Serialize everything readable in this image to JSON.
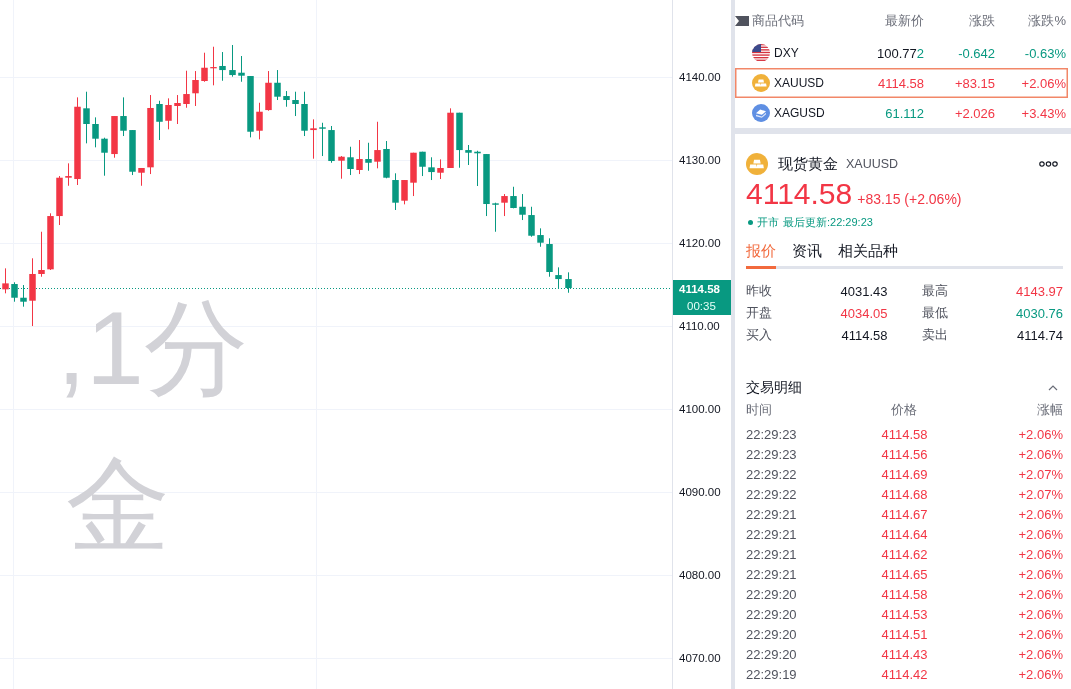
{
  "chart": {
    "watermark": [
      ",1分",
      "金"
    ],
    "chart_data": [
      {
        "type": "candlestick",
        "ohlc": [
          [
            4114.42,
            4116.95,
            4113.94,
            4115.14
          ],
          [
            4115.06,
            4115.27,
            4112.93,
            4113.41
          ],
          [
            4113.41,
            4114.94,
            4112.33,
            4112.93
          ],
          [
            4113.05,
            4118.16,
            4110.0,
            4116.27
          ],
          [
            4116.27,
            4121.36,
            4115.94,
            4116.75
          ],
          [
            4116.83,
            4123.58,
            4116.75,
            4123.25
          ],
          [
            4123.25,
            4128.07,
            4122.17,
            4127.87
          ],
          [
            4127.87,
            4129.6,
            4126.9,
            4128.07
          ],
          [
            4127.71,
            4137.55,
            4126.99,
            4136.42
          ],
          [
            4136.23,
            4138.23,
            4132.01,
            4134.34
          ],
          [
            4134.34,
            4135.14,
            4131.53,
            4132.57
          ],
          [
            4132.57,
            4132.69,
            4128.11,
            4130.88
          ],
          [
            4130.72,
            4135.3,
            4130.28,
            4135.3
          ],
          [
            4135.3,
            4137.55,
            4132.89,
            4133.53
          ],
          [
            4133.61,
            4133.61,
            4128.19,
            4128.59
          ],
          [
            4128.47,
            4129.04,
            4126.9,
            4129.04
          ],
          [
            4129.12,
            4137.83,
            4128.31,
            4136.27
          ],
          [
            4136.75,
            4137.14,
            4132.41,
            4134.61
          ],
          [
            4134.73,
            4137.43,
            4133.7,
            4136.63
          ],
          [
            4136.51,
            4137.83,
            4134.34,
            4136.87
          ],
          [
            4136.75,
            4140.76,
            4136.3,
            4137.95
          ],
          [
            4138.04,
            4140.72,
            4136.51,
            4139.64
          ],
          [
            4139.52,
            4142.93,
            4139.43,
            4141.12
          ],
          [
            4141.05,
            4143.65,
            4139.0,
            4141.2
          ],
          [
            4141.33,
            4143.01,
            4139.55,
            4140.84
          ],
          [
            4140.84,
            4143.86,
            4140.04,
            4140.24
          ],
          [
            4140.52,
            4142.53,
            4139.43,
            4140.16
          ],
          [
            4140.12,
            4140.12,
            4132.73,
            4133.41
          ],
          [
            4133.53,
            4136.9,
            4132.49,
            4135.82
          ],
          [
            4136.02,
            4140.72,
            4135.94,
            4139.31
          ],
          [
            4139.31,
            4140.84,
            4137.23,
            4137.63
          ],
          [
            4137.71,
            4138.31,
            4136.42,
            4137.23
          ],
          [
            4137.23,
            4138.23,
            4135.3,
            4136.75
          ],
          [
            4136.75,
            4138.23,
            4132.89,
            4133.53
          ],
          [
            4133.61,
            4134.9,
            4130.16,
            4133.82
          ],
          [
            4133.94,
            4134.49,
            4130.48,
            4133.77
          ],
          [
            4133.61,
            4134.1,
            4129.67,
            4129.88
          ],
          [
            4129.92,
            4130.48,
            4127.75,
            4130.4
          ],
          [
            4130.33,
            4131.6,
            4128.19,
            4128.92
          ],
          [
            4128.8,
            4132.41,
            4128.31,
            4130.12
          ],
          [
            4130.12,
            4132.08,
            4128.71,
            4129.67
          ],
          [
            4129.8,
            4134.61,
            4129.0,
            4131.2
          ],
          [
            4131.33,
            4132.29,
            4127.8,
            4127.87
          ],
          [
            4127.59,
            4128.4,
            4123.98,
            4124.86
          ],
          [
            4125.1,
            4127.59,
            4124.66,
            4127.59
          ],
          [
            4127.27,
            4130.88,
            4125.66,
            4130.88
          ],
          [
            4131.0,
            4131.0,
            4128.07,
            4129.19
          ],
          [
            4129.12,
            4130.33,
            4127.59,
            4128.55
          ],
          [
            4128.47,
            4130.08,
            4127.71,
            4129.04
          ],
          [
            4129.04,
            4136.23,
            4129.04,
            4135.7
          ],
          [
            4135.7,
            4135.7,
            4129.07,
            4131.2
          ],
          [
            4131.2,
            4131.81,
            4129.4,
            4130.88
          ],
          [
            4131.0,
            4131.12,
            4126.87,
            4130.81
          ],
          [
            4130.72,
            4130.72,
            4123.25,
            4124.7
          ],
          [
            4124.78,
            4124.86,
            4121.36,
            4124.61
          ],
          [
            4124.86,
            4125.9,
            4123.25,
            4125.66
          ],
          [
            4125.66,
            4126.78,
            4124.18,
            4124.22
          ],
          [
            4124.37,
            4125.9,
            4122.77,
            4123.41
          ],
          [
            4123.37,
            4124.37,
            4120.76,
            4120.88
          ],
          [
            4120.96,
            4121.77,
            4119.55,
            4120.04
          ],
          [
            4119.88,
            4120.57,
            4115.94,
            4116.51
          ],
          [
            4116.14,
            4117.07,
            4114.54,
            4115.66
          ],
          [
            4115.66,
            4116.47,
            4114.01,
            4114.58
          ],
          null,
          null,
          null,
          null,
          null,
          null,
          null,
          null,
          null,
          null,
          null
        ],
        "ylim": [
          4066.27,
          4149.28
        ],
        "yticks": [
          {
            "value": 4140,
            "label": "4140.00"
          },
          {
            "value": 4130,
            "label": "4130.00"
          },
          {
            "value": 4120,
            "label": "4120.00"
          },
          {
            "value": 4110,
            "label": "4110.00"
          },
          {
            "value": 4100,
            "label": "4100.00"
          },
          {
            "value": 4090,
            "label": "4090.00"
          },
          {
            "value": 4080,
            "label": "4080.00"
          },
          {
            "value": 4070,
            "label": "4070.00"
          }
        ],
        "tick_labels": "y",
        "grid": true,
        "ref_lines": [
          {
            "axis": "y",
            "value": 4114.58,
            "color": "#089981",
            "line_style": "dotted"
          }
        ]
      }
    ],
    "price_tag": {
      "price": "4114.58",
      "countdown": "00:35"
    }
  },
  "watchlist": {
    "columns": [
      "商品代码",
      "最新价",
      "涨跌",
      "涨跌%"
    ],
    "rows": [
      {
        "kind": "flag",
        "symbol": "DXY",
        "last_parts": [
          {
            "text": "100.77",
            "color": "#131722"
          },
          {
            "text": "2",
            "color": "#089981"
          }
        ],
        "change": "-0.642",
        "change_pct": "-0.63%",
        "color": "#089981",
        "selected": false
      },
      {
        "kind": "gold",
        "symbol": "XAUUSD",
        "last_parts": [
          {
            "text": "4114.58",
            "color": "#f23645"
          }
        ],
        "change": "+83.15",
        "change_pct": "+2.06%",
        "color": "#f23645",
        "selected": true
      },
      {
        "kind": "silver",
        "symbol": "XAGUSD",
        "last_parts": [
          {
            "text": "61.112",
            "color": "#089981"
          }
        ],
        "change": "+2.026",
        "change_pct": "+3.43%",
        "color": "#f23645",
        "selected": false
      }
    ]
  },
  "quote": {
    "kind": "gold",
    "name": "现货黄金",
    "symbol": "XAUUSD",
    "price": "4114.58",
    "change": "+83.15 (+2.06%)",
    "color": "#f23645",
    "market_open": true,
    "status": "开市",
    "updated": "最后更新:22:29:23",
    "tabs": [
      {
        "label": "报价",
        "selected": true
      },
      {
        "label": "资讯",
        "selected": false
      },
      {
        "label": "相关品种",
        "selected": false
      }
    ],
    "stats": [
      {
        "label": "昨收",
        "value": "4031.43",
        "color": "#131722"
      },
      {
        "label": "最高",
        "value": "4143.97",
        "color": "#f23645"
      },
      {
        "label": "开盘",
        "value": "4034.05",
        "color": "#f23645"
      },
      {
        "label": "最低",
        "value": "4030.76",
        "color": "#089981"
      },
      {
        "label": "买入",
        "value": "4114.58",
        "color": "#131722"
      },
      {
        "label": "卖出",
        "value": "4114.74",
        "color": "#131722"
      }
    ]
  },
  "trades": {
    "title": "交易明细",
    "expanded": true,
    "columns": [
      "时间",
      "价格",
      "涨幅"
    ],
    "rows": [
      {
        "time": "22:29:23",
        "price": "4114.58",
        "change": "+2.06%",
        "color": "#f23645"
      },
      {
        "time": "22:29:23",
        "price": "4114.56",
        "change": "+2.06%",
        "color": "#f23645"
      },
      {
        "time": "22:29:22",
        "price": "4114.69",
        "change": "+2.07%",
        "color": "#f23645"
      },
      {
        "time": "22:29:22",
        "price": "4114.68",
        "change": "+2.07%",
        "color": "#f23645"
      },
      {
        "time": "22:29:21",
        "price": "4114.67",
        "change": "+2.06%",
        "color": "#f23645"
      },
      {
        "time": "22:29:21",
        "price": "4114.64",
        "change": "+2.06%",
        "color": "#f23645"
      },
      {
        "time": "22:29:21",
        "price": "4114.62",
        "change": "+2.06%",
        "color": "#f23645"
      },
      {
        "time": "22:29:21",
        "price": "4114.65",
        "change": "+2.06%",
        "color": "#f23645"
      },
      {
        "time": "22:29:20",
        "price": "4114.58",
        "change": "+2.06%",
        "color": "#f23645"
      },
      {
        "time": "22:29:20",
        "price": "4114.53",
        "change": "+2.06%",
        "color": "#f23645"
      },
      {
        "time": "22:29:20",
        "price": "4114.51",
        "change": "+2.06%",
        "color": "#f23645"
      },
      {
        "time": "22:29:20",
        "price": "4114.43",
        "change": "+2.06%",
        "color": "#f23645"
      },
      {
        "time": "22:29:19",
        "price": "4114.42",
        "change": "+2.06%",
        "color": "#f23645"
      }
    ]
  }
}
